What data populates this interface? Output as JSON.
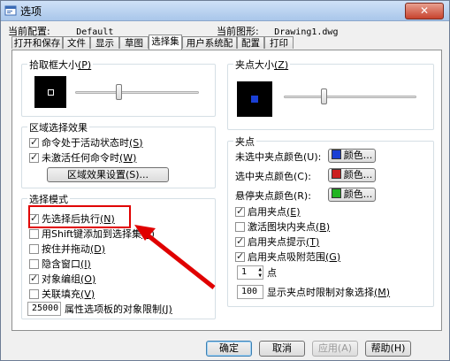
{
  "window": {
    "title": "选项",
    "close_glyph": "✕"
  },
  "header": {
    "profile_label": "当前配置:",
    "profile_value": "Default",
    "drawing_label": "当前图形:",
    "drawing_value": "Drawing1.dwg"
  },
  "tabs": [
    "打开和保存",
    "文件",
    "显示",
    "草图",
    "选择集",
    "用户系统配置",
    "配置",
    "打印"
  ],
  "active_tab": "选择集",
  "pickbox": {
    "title": "拾取框大小",
    "key": "(P)",
    "level": 0.35
  },
  "selection_preview": {
    "title": "区域选择效果",
    "opt1": "命令处于活动状态时",
    "opt1_key": "(S)",
    "opt1_checked": true,
    "opt2": "未激活任何命令时",
    "opt2_key": "(W)",
    "opt2_checked": true,
    "button": "区域效果设置(S)..."
  },
  "selection_modes": {
    "title": "选择模式",
    "items": [
      {
        "label": "先选择后执行",
        "key": "(N)",
        "checked": true
      },
      {
        "label": "用Shift键添加到选择集",
        "key": "(F)",
        "checked": false
      },
      {
        "label": "按住并拖动",
        "key": "(D)",
        "checked": false
      },
      {
        "label": "隐含窗口",
        "key": "(I)",
        "checked": false
      },
      {
        "label": "对象编组",
        "key": "(O)",
        "checked": true
      },
      {
        "label": "关联填充",
        "key": "(V)",
        "checked": false
      }
    ],
    "limit_value": "25000",
    "limit_label": "属性选项板的对象限制",
    "limit_key": "(J)"
  },
  "grip_size": {
    "title": "夹点大小",
    "key": "(Z)",
    "level": 0.3
  },
  "grips": {
    "title": "夹点",
    "colors": [
      {
        "label": "未选中夹点颜色",
        "key": "(U):",
        "button": "颜色...",
        "color": "#1a3fd4"
      },
      {
        "label": "选中夹点颜色",
        "key": "(C):",
        "button": "颜色...",
        "color": "#cc1f1f"
      },
      {
        "label": "悬停夹点颜色",
        "key": "(R):",
        "button": "颜色...",
        "color": "#22b422"
      }
    ],
    "options": [
      {
        "label": "启用夹点",
        "key": "(E)",
        "checked": true
      },
      {
        "label": "激活图块内夹点",
        "key": "(B)",
        "checked": false
      },
      {
        "label": "启用夹点提示",
        "key": "(T)",
        "checked": true
      },
      {
        "label": "启用夹点吸附范围",
        "key": "(G)",
        "checked": true
      }
    ],
    "spin_value": "1",
    "spin_label": "点",
    "limit_value": "100",
    "limit_label": "显示夹点时限制对象选择",
    "limit_key": "(M)"
  },
  "buttons": {
    "ok": "确定",
    "cancel": "取消",
    "apply": "应用(A)",
    "help": "帮助(H)"
  },
  "annotation": {
    "color": "#e00000"
  }
}
